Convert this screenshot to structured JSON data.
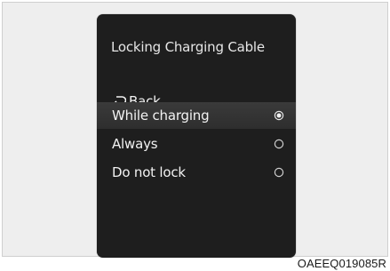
{
  "screen": {
    "title": "Locking Charging Cable",
    "back": {
      "icon": "back-arrow-icon",
      "label": "Back"
    },
    "options": [
      {
        "label": "While charging",
        "selected": true
      },
      {
        "label": "Always",
        "selected": false
      },
      {
        "label": "Do not lock",
        "selected": false
      }
    ]
  },
  "caption": "OAEEQ019085R",
  "colors": {
    "screen_background": "#1e1e1e",
    "text": "#f2f2f2",
    "selected_row": "#363636"
  }
}
